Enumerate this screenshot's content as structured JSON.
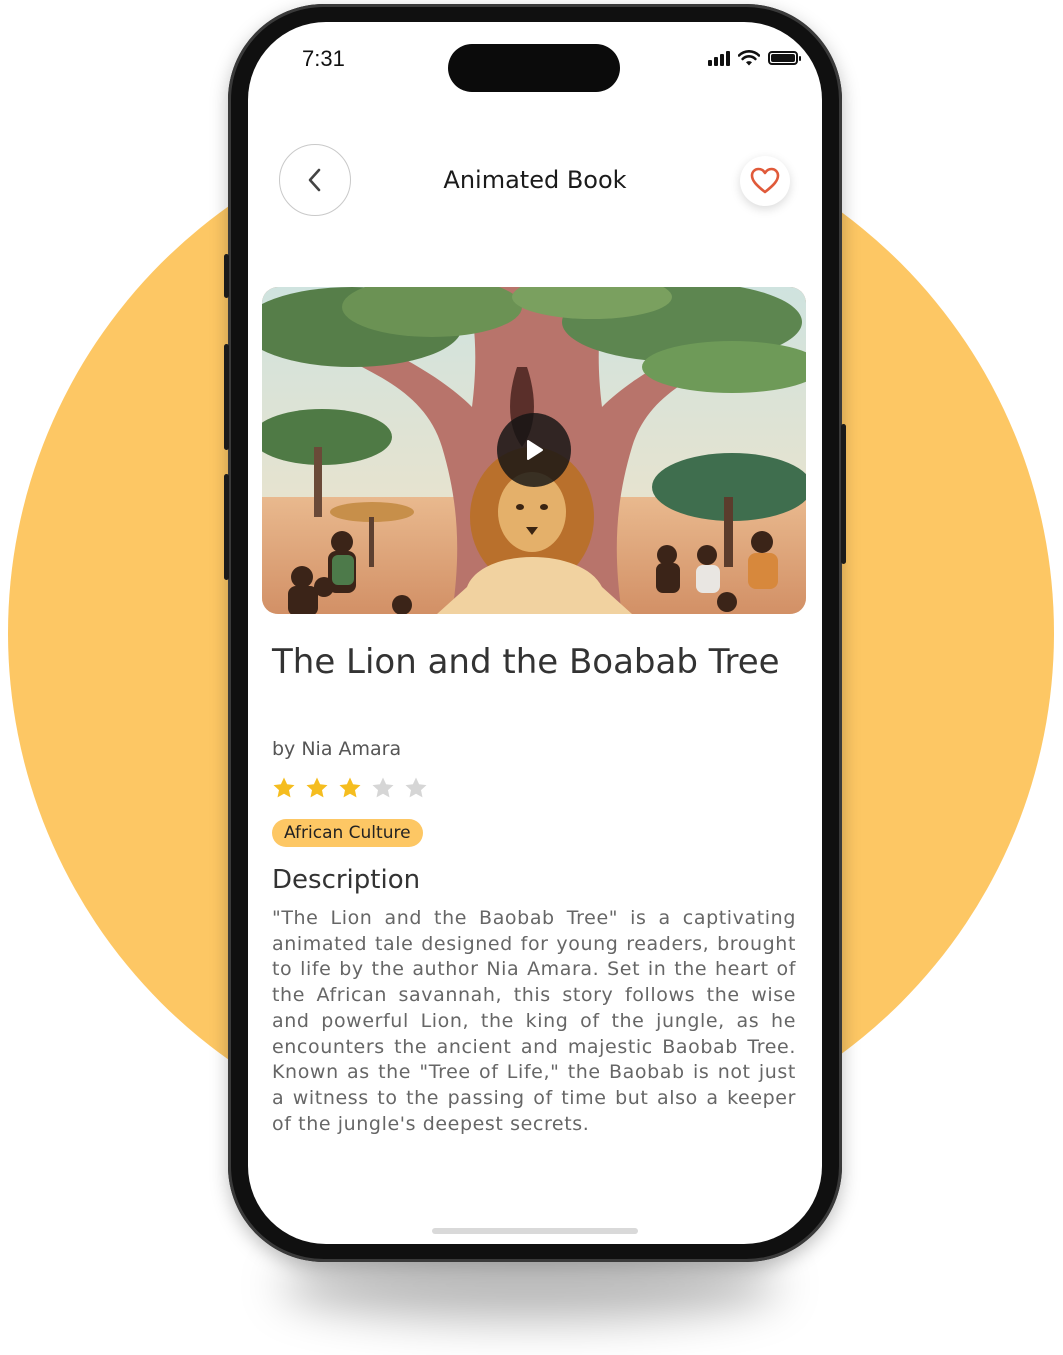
{
  "status_bar": {
    "time": "7:31"
  },
  "header": {
    "title": "Animated Book"
  },
  "book": {
    "title": "The Lion and the Boabab Tree",
    "author": "by Nia Amara",
    "rating": 3,
    "rating_max": 5,
    "category": "African Culture"
  },
  "description": {
    "heading": "Description",
    "body": "\"The Lion and the Baobab Tree\" is a captivating animated tale designed for young readers, brought to life by the author Nia Amara. Set in the heart of the African savannah, this story follows the wise and powerful Lion, the king of the jungle, as he encounters the ancient and majestic Baobab Tree. Known as the \"Tree of Life,\" the Baobab is not just a witness to the passing of time but also a keeper of the jungle's deepest secrets."
  },
  "colors": {
    "accent": "#fdc764",
    "heart": "#e05a3a",
    "star_filled": "#f5bd1f",
    "star_empty": "#d6d6d6"
  }
}
